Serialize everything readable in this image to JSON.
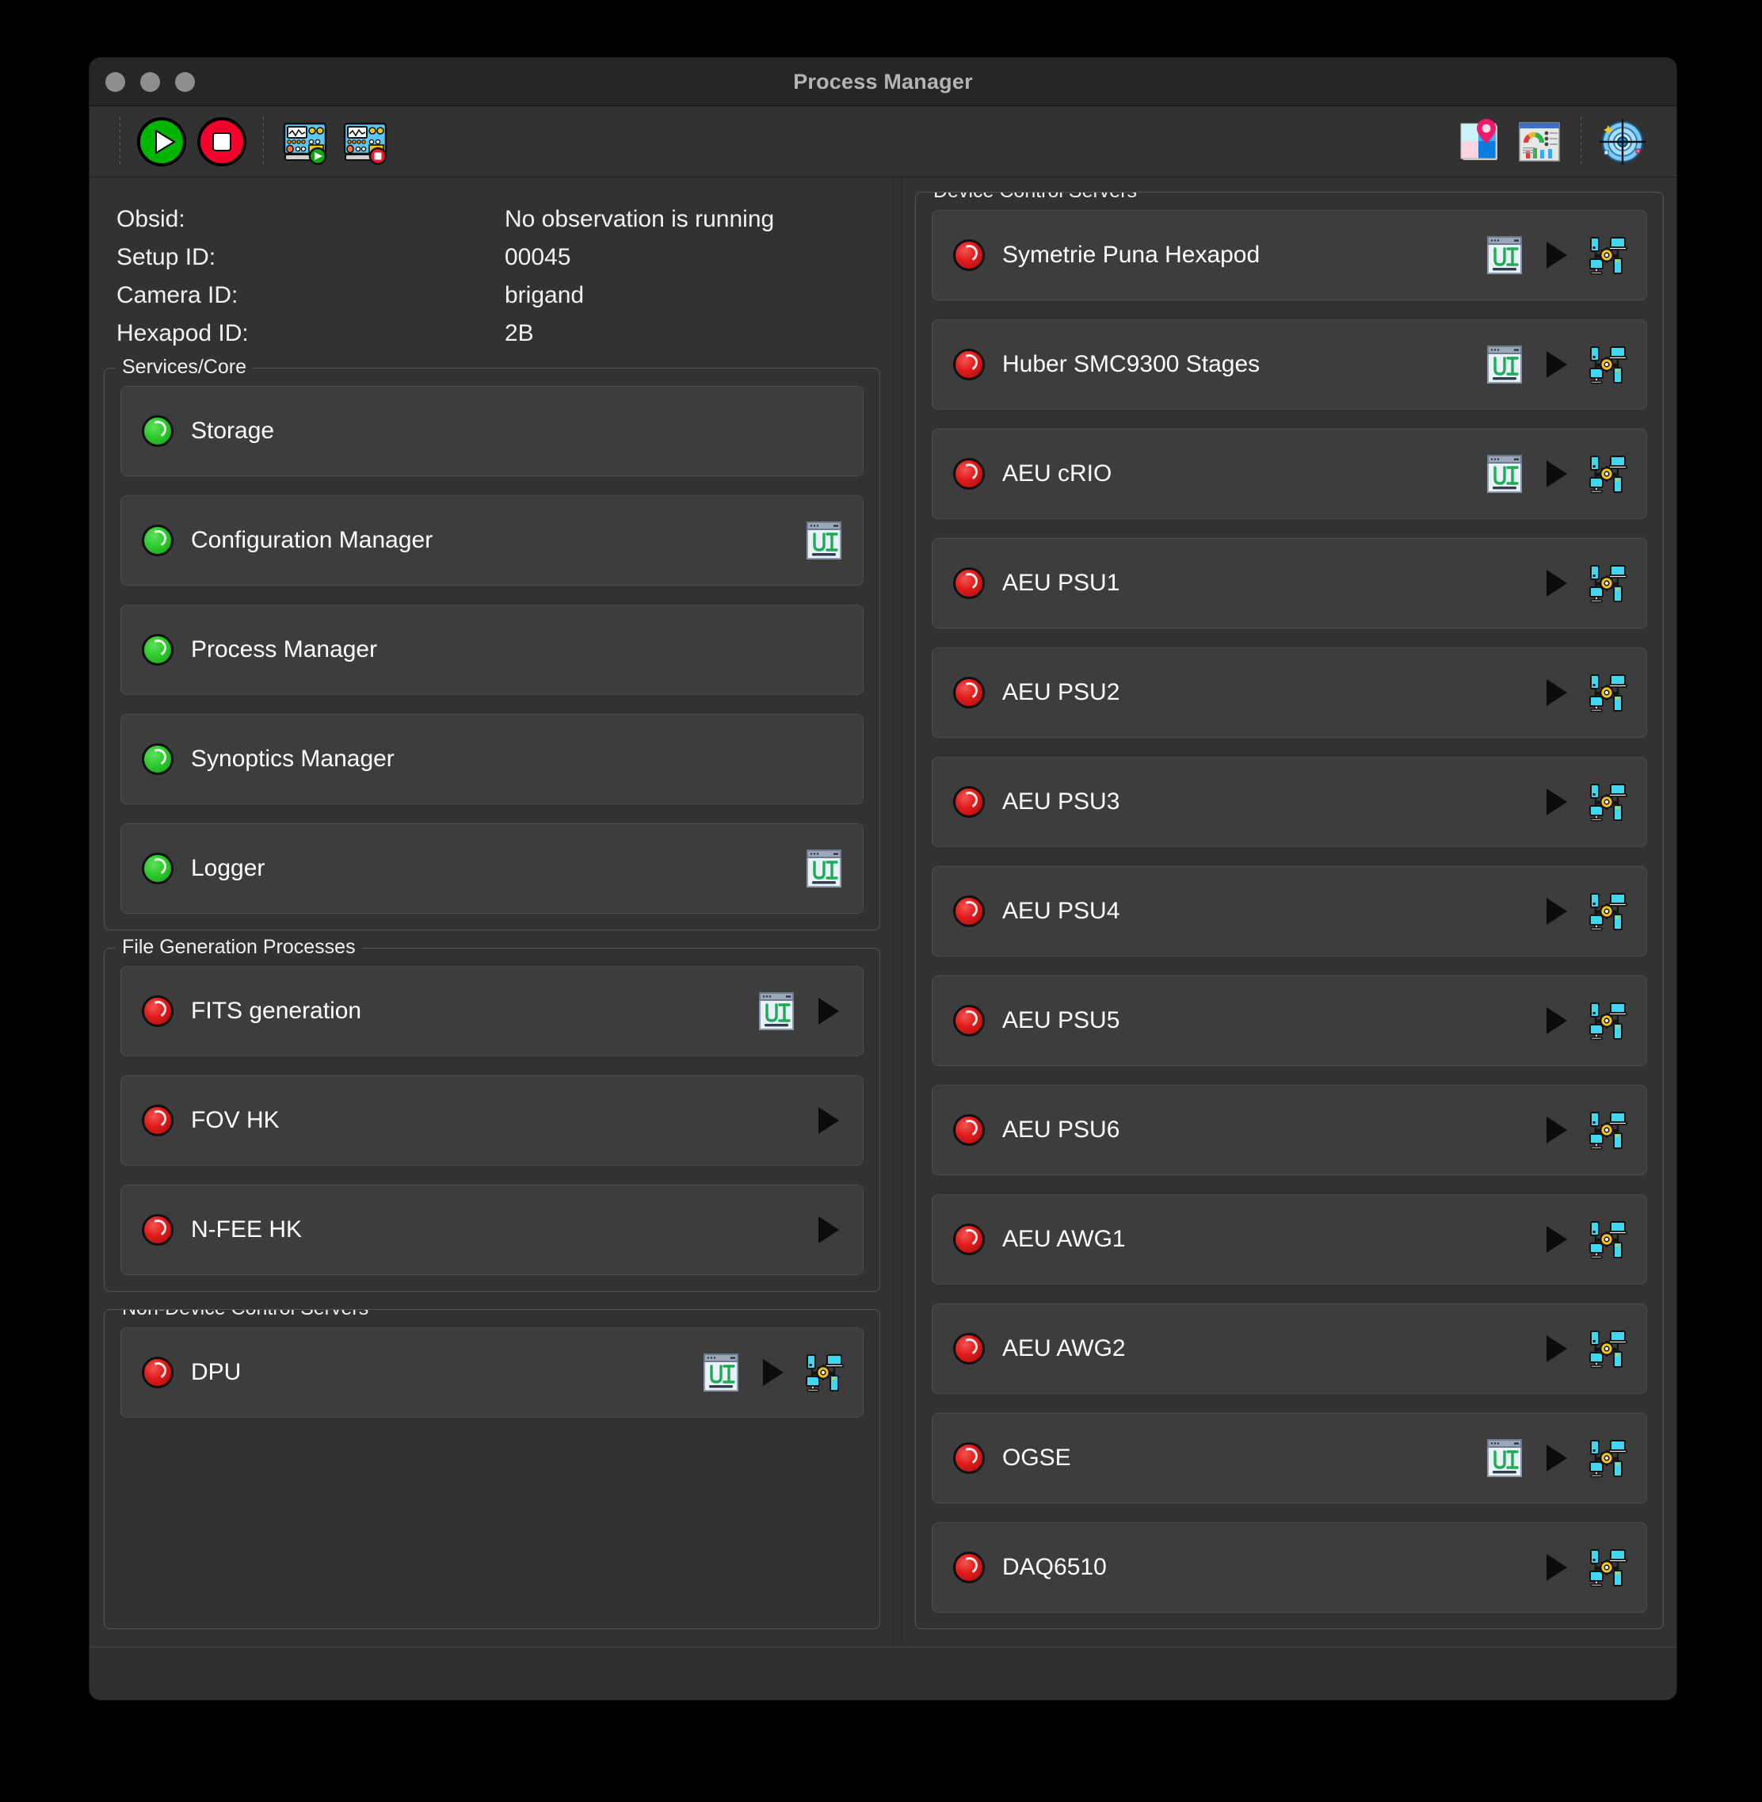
{
  "window": {
    "title": "Process Manager",
    "traffic_lights": [
      "close",
      "minimize",
      "zoom"
    ]
  },
  "toolbar": {
    "left_buttons": [
      {
        "name": "start-all-button",
        "icon": "play-circle-green",
        "label": "Start"
      },
      {
        "name": "stop-all-button",
        "icon": "stop-circle-red",
        "label": "Stop"
      },
      {
        "name": "start-device-servers-button",
        "icon": "instrument-start",
        "label": "Start Device Servers"
      },
      {
        "name": "stop-device-servers-button",
        "icon": "instrument-stop",
        "label": "Stop Device Servers"
      }
    ],
    "right_buttons": [
      {
        "name": "setup-button",
        "icon": "quadrant-pin-icon",
        "label": "Setup"
      },
      {
        "name": "dashboard-button",
        "icon": "dashboard-icon",
        "label": "Dashboard"
      },
      {
        "name": "target-button",
        "icon": "target-icon",
        "label": "Target"
      }
    ]
  },
  "info": {
    "rows": [
      {
        "key": "Obsid:",
        "value": "No observation is running"
      },
      {
        "key": "Setup ID:",
        "value": "00045"
      },
      {
        "key": "Camera ID:",
        "value": "brigand"
      },
      {
        "key": "Hexapod ID:",
        "value": "2B"
      }
    ]
  },
  "colors": {
    "led_green": "#2fcb2f",
    "led_red": "#e01c1c",
    "window_bg": "#323232",
    "row_bg": "#3d3d3d",
    "row_border": "#4c4c4c",
    "group_border": "#555555",
    "text": "#ffffff",
    "title_text": "#b4b4b4",
    "ui_icon_accent": "#1faa55",
    "net_icon_accent": "#3fd8f0"
  },
  "left_panel": {
    "groups": [
      {
        "title": "Services/Core",
        "name": "services-core-group",
        "items": [
          {
            "label": "Storage",
            "status": "green",
            "ui": false,
            "play": false,
            "net": false
          },
          {
            "label": "Configuration Manager",
            "status": "green",
            "ui": true,
            "play": false,
            "net": false
          },
          {
            "label": "Process Manager",
            "status": "green",
            "ui": false,
            "play": false,
            "net": false
          },
          {
            "label": "Synoptics Manager",
            "status": "green",
            "ui": false,
            "play": false,
            "net": false
          },
          {
            "label": "Logger",
            "status": "green",
            "ui": true,
            "play": false,
            "net": false
          }
        ]
      },
      {
        "title": "File Generation Processes",
        "name": "file-generation-processes-group",
        "items": [
          {
            "label": "FITS generation",
            "status": "red",
            "ui": true,
            "play": true,
            "net": false
          },
          {
            "label": "FOV HK",
            "status": "red",
            "ui": false,
            "play": true,
            "net": false
          },
          {
            "label": "N-FEE HK",
            "status": "red",
            "ui": false,
            "play": true,
            "net": false
          }
        ]
      },
      {
        "title": "Non-Device Control Servers",
        "name": "non-device-control-servers-group",
        "items": [
          {
            "label": "DPU",
            "status": "red",
            "ui": true,
            "play": true,
            "net": true
          }
        ]
      }
    ]
  },
  "right_panel": {
    "group": {
      "title": "Device Control Servers",
      "name": "device-control-servers-group",
      "items": [
        {
          "label": "Symetrie Puna Hexapod",
          "status": "red",
          "ui": true,
          "play": true,
          "net": true
        },
        {
          "label": "Huber SMC9300 Stages",
          "status": "red",
          "ui": true,
          "play": true,
          "net": true
        },
        {
          "label": "AEU cRIO",
          "status": "red",
          "ui": true,
          "play": true,
          "net": true
        },
        {
          "label": "AEU PSU1",
          "status": "red",
          "ui": false,
          "play": true,
          "net": true
        },
        {
          "label": "AEU PSU2",
          "status": "red",
          "ui": false,
          "play": true,
          "net": true
        },
        {
          "label": "AEU PSU3",
          "status": "red",
          "ui": false,
          "play": true,
          "net": true
        },
        {
          "label": "AEU PSU4",
          "status": "red",
          "ui": false,
          "play": true,
          "net": true
        },
        {
          "label": "AEU PSU5",
          "status": "red",
          "ui": false,
          "play": true,
          "net": true
        },
        {
          "label": "AEU PSU6",
          "status": "red",
          "ui": false,
          "play": true,
          "net": true
        },
        {
          "label": "AEU AWG1",
          "status": "red",
          "ui": false,
          "play": true,
          "net": true
        },
        {
          "label": "AEU AWG2",
          "status": "red",
          "ui": false,
          "play": true,
          "net": true
        },
        {
          "label": "OGSE",
          "status": "red",
          "ui": true,
          "play": true,
          "net": true
        },
        {
          "label": "DAQ6510",
          "status": "red",
          "ui": false,
          "play": true,
          "net": true
        }
      ]
    }
  }
}
